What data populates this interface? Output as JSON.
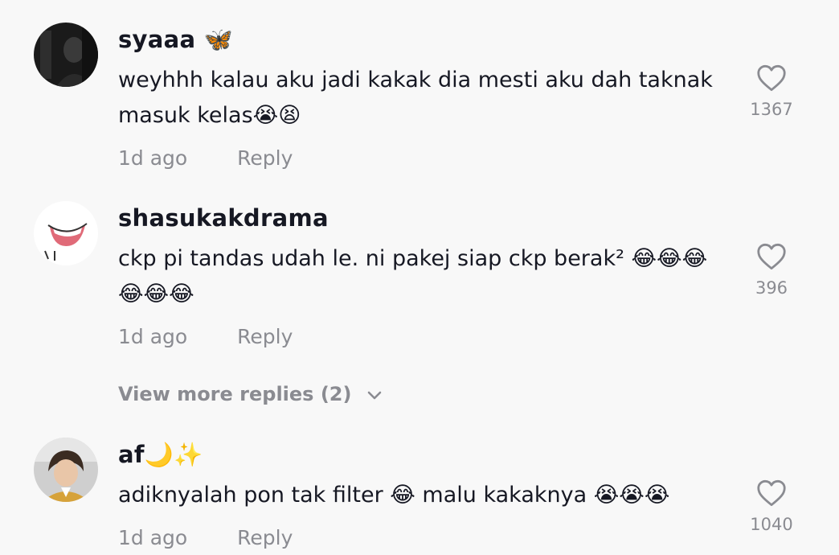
{
  "comments": [
    {
      "username": "syaaa 🦋",
      "text": "weyhhh kalau aku jadi kakak dia mesti aku dah taknak masuk kelas😭😫",
      "time": "1d ago",
      "reply": "Reply",
      "likes": "1367",
      "avatar_icon": "dark-photo-avatar"
    },
    {
      "username": "shasukakdrama",
      "text": "ckp pi tandas udah le. ni pakej siap ckp berak² 😂😂😂 😂😂😂",
      "time": "1d ago",
      "reply": "Reply",
      "likes": "396",
      "avatar_icon": "smile-drawing-avatar"
    },
    {
      "username": "af🌙✨",
      "text": "adiknyalah pon tak filter 😂 malu kakaknya 😭😭😭",
      "time": "1d ago",
      "reply": "Reply",
      "likes": "1040",
      "avatar_icon": "person-photo-avatar"
    }
  ],
  "view_more": {
    "label": "View more replies (2)",
    "icon": "chevron-down-icon"
  },
  "colors": {
    "background": "#f8f8f8",
    "primary_text": "#161823",
    "secondary_text": "#8a8b91"
  }
}
